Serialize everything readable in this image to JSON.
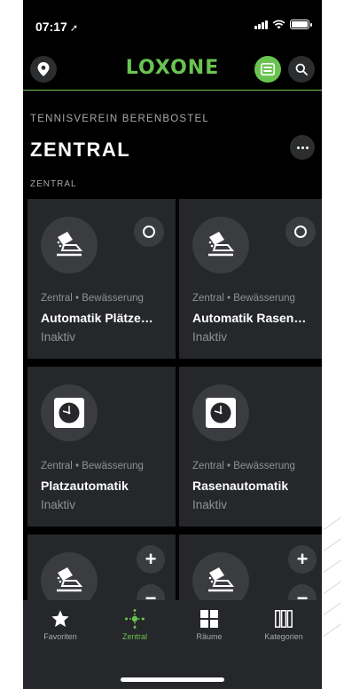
{
  "status_bar": {
    "time": "07:17",
    "location_arrow": "➚"
  },
  "header": {
    "logo": "LOXONE"
  },
  "page": {
    "subtitle": "TENNISVEREIN BERENBOSTEL",
    "title": "ZENTRAL",
    "section": "ZENTRAL"
  },
  "cards": [
    {
      "meta": "Zentral • Bewässerung",
      "name": "Automatik Plätze…",
      "state": "Inaktiv",
      "icon": "irrigation-icon",
      "control": "toggle-off"
    },
    {
      "meta": "Zentral • Bewässerung",
      "name": "Automatik Rasen…",
      "state": "Inaktiv",
      "icon": "irrigation-icon",
      "control": "toggle-off"
    },
    {
      "meta": "Zentral • Bewässerung",
      "name": "Platzautomatik",
      "state": "Inaktiv",
      "icon": "clock-icon"
    },
    {
      "meta": "Zentral • Bewässerung",
      "name": "Rasenautomatik",
      "state": "Inaktiv",
      "icon": "clock-icon"
    },
    {
      "icon": "irrigation-icon",
      "plus": "+",
      "minus": "−"
    },
    {
      "icon": "irrigation-icon",
      "plus": "+",
      "minus": "−"
    }
  ],
  "tabs": [
    {
      "label": "Favoriten",
      "icon": "star-icon",
      "active": false
    },
    {
      "label": "Zentral",
      "icon": "network-icon",
      "active": true
    },
    {
      "label": "Räume",
      "icon": "grid-icon",
      "active": false
    },
    {
      "label": "Kategorien",
      "icon": "columns-icon",
      "active": false
    }
  ],
  "colors": {
    "accent": "#69c350",
    "card": "#25272a",
    "background": "#000000"
  }
}
